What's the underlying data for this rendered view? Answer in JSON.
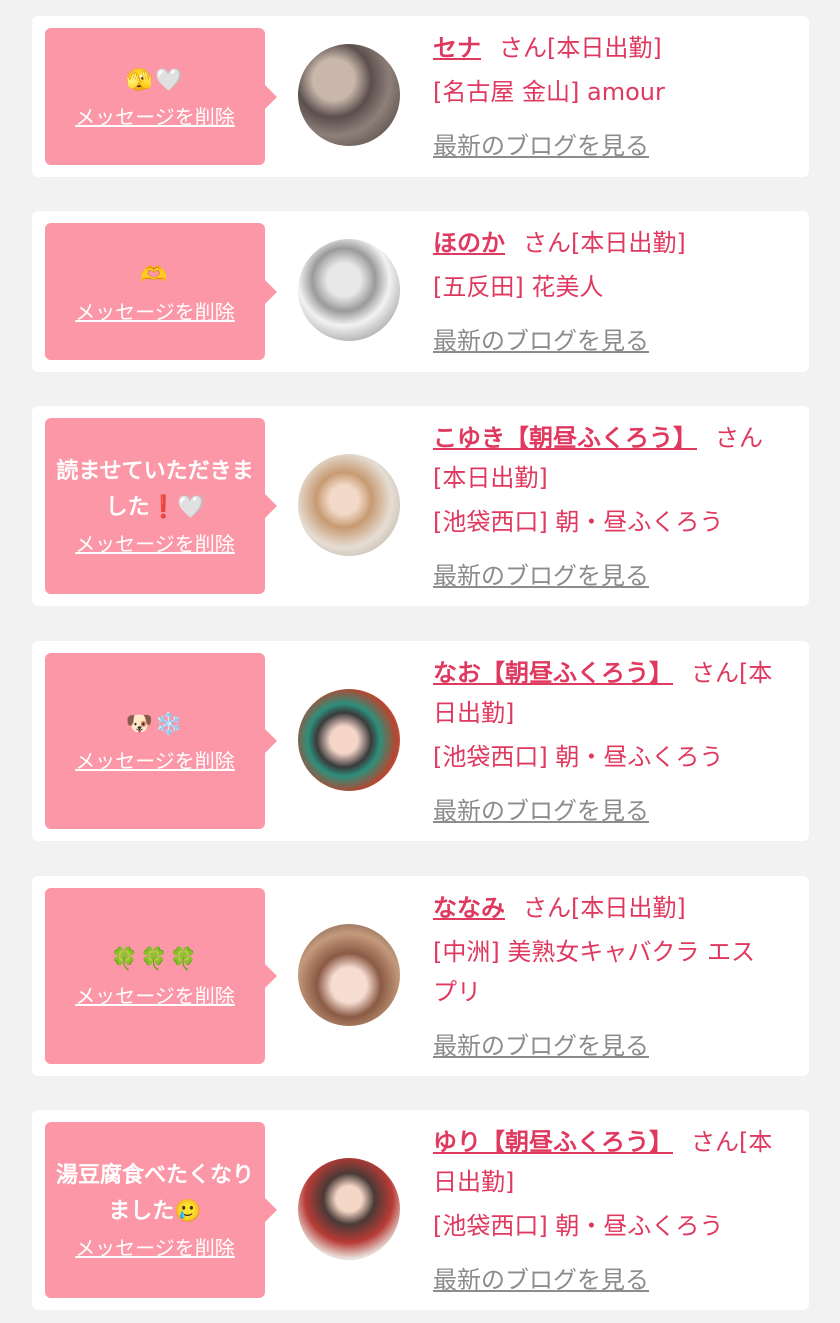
{
  "delete_label": "メッセージを削除",
  "blog_label": "最新のブログを見る",
  "colors": {
    "page_bg": "#f2f2f2",
    "card_bg": "#ffffff",
    "bubble_bg": "#fb97a6",
    "accent": "#e0395f",
    "link_gray": "#8c8c8c"
  },
  "entries": [
    {
      "message": "🫣🤍",
      "name": "セナ",
      "suffix": "さん[本日出勤]",
      "shop": "[名古屋 金山] amour"
    },
    {
      "message": "🫶",
      "name": "ほのか",
      "suffix": "さん[本日出勤]",
      "shop": "[五反田] 花美人"
    },
    {
      "message": "読ませていただきました❗️🤍",
      "name": "こゆき【朝昼ふくろう】",
      "suffix": "さん[本日出勤]",
      "shop": "[池袋西口] 朝・昼ふくろう"
    },
    {
      "message": "🐶❄️",
      "name": "なお【朝昼ふくろう】",
      "suffix": "さん[本日出勤]",
      "shop": "[池袋西口] 朝・昼ふくろう"
    },
    {
      "message": "🍀🍀🍀",
      "name": "ななみ",
      "suffix": "さん[本日出勤]",
      "shop": "[中洲] 美熟女キャバクラ エスプリ"
    },
    {
      "message": "湯豆腐食べたくなりました🥲",
      "name": "ゆり【朝昼ふくろう】",
      "suffix": "さん[本日出勤]",
      "shop": "[池袋西口] 朝・昼ふくろう"
    }
  ]
}
